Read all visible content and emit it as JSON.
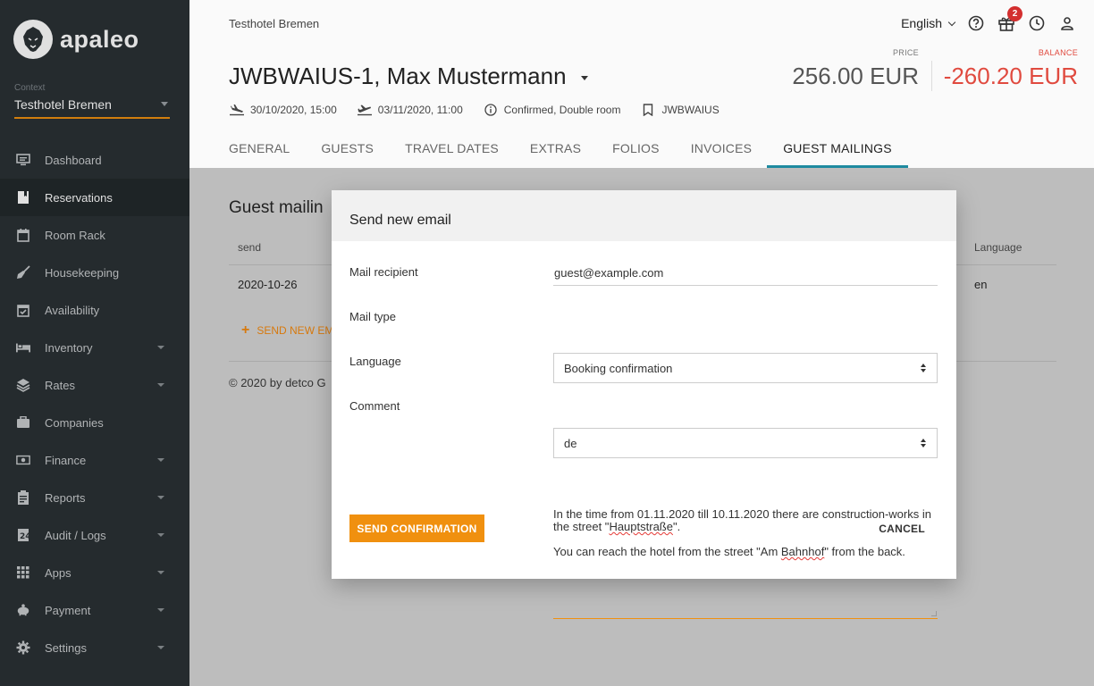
{
  "brand": {
    "name": "apaleo"
  },
  "sidebar": {
    "context_label": "Context",
    "context_value": "Testhotel Bremen",
    "items": [
      {
        "label": "Dashboard",
        "icon": "monitor-icon",
        "has_submenu": false
      },
      {
        "label": "Reservations",
        "icon": "bookmark-icon",
        "has_submenu": false,
        "active": true
      },
      {
        "label": "Room Rack",
        "icon": "calendar-icon",
        "has_submenu": false
      },
      {
        "label": "Housekeeping",
        "icon": "broom-icon",
        "has_submenu": false
      },
      {
        "label": "Availability",
        "icon": "calendar-check-icon",
        "has_submenu": false
      },
      {
        "label": "Inventory",
        "icon": "bed-icon",
        "has_submenu": true
      },
      {
        "label": "Rates",
        "icon": "layers-icon",
        "has_submenu": true
      },
      {
        "label": "Companies",
        "icon": "briefcase-icon",
        "has_submenu": false
      },
      {
        "label": "Finance",
        "icon": "money-icon",
        "has_submenu": true
      },
      {
        "label": "Reports",
        "icon": "clipboard-icon",
        "has_submenu": true
      },
      {
        "label": "Audit / Logs",
        "icon": "audit-icon",
        "has_submenu": true
      },
      {
        "label": "Apps",
        "icon": "grid-icon",
        "has_submenu": true
      },
      {
        "label": "Payment",
        "icon": "piggy-bank-icon",
        "has_submenu": true
      },
      {
        "label": "Settings",
        "icon": "gear-icon",
        "has_submenu": true
      }
    ]
  },
  "header": {
    "hotel_name": "Testhotel Bremen",
    "language": "English",
    "gift_badge": "2",
    "reservation_title": "JWBWAIUS-1, Max Mustermann",
    "price_label": "PRICE",
    "price_value": "256.00 EUR",
    "balance_label": "BALANCE",
    "balance_value": "-260.20 EUR",
    "arrival": "30/10/2020, 15:00",
    "departure": "03/11/2020, 11:00",
    "status": "Confirmed, Double room",
    "booking_id": "JWBWAIUS",
    "tabs": [
      "GENERAL",
      "GUESTS",
      "TRAVEL DATES",
      "EXTRAS",
      "FOLIOS",
      "INVOICES",
      "GUEST MAILINGS"
    ],
    "active_tab": "GUEST MAILINGS"
  },
  "content": {
    "title": "Guest mailin",
    "col_send": "send",
    "col_language": "Language",
    "row_date": "2020-10-26",
    "row_language": "en",
    "send_new_label": "SEND NEW EM",
    "copyright": "© 2020 by detco G"
  },
  "modal": {
    "title": "Send new email",
    "recipient_label": "Mail recipient",
    "recipient_value": "guest@example.com",
    "mailtype_label": "Mail type",
    "mailtype_value": "Booking confirmation",
    "language_label": "Language",
    "language_value": "de",
    "comment_label": "Comment",
    "comment_line1a": "In the time from 01.11.2020 till 10.11.2020 there are construction-works in the street \"",
    "comment_word1": "Hauptstraße",
    "comment_line1b": "\".",
    "comment_line2a": "You can reach the hotel from the street \"Am ",
    "comment_word2": "Bahnhof",
    "comment_line2b": "\" from the back.",
    "send_button": "SEND CONFIRMATION",
    "cancel_button": "CANCEL"
  },
  "colors": {
    "accent": "#f0900f",
    "tab_indicator": "#1e8aa0",
    "balance": "#e04a3f",
    "sidebar_bg": "#2b3135"
  }
}
